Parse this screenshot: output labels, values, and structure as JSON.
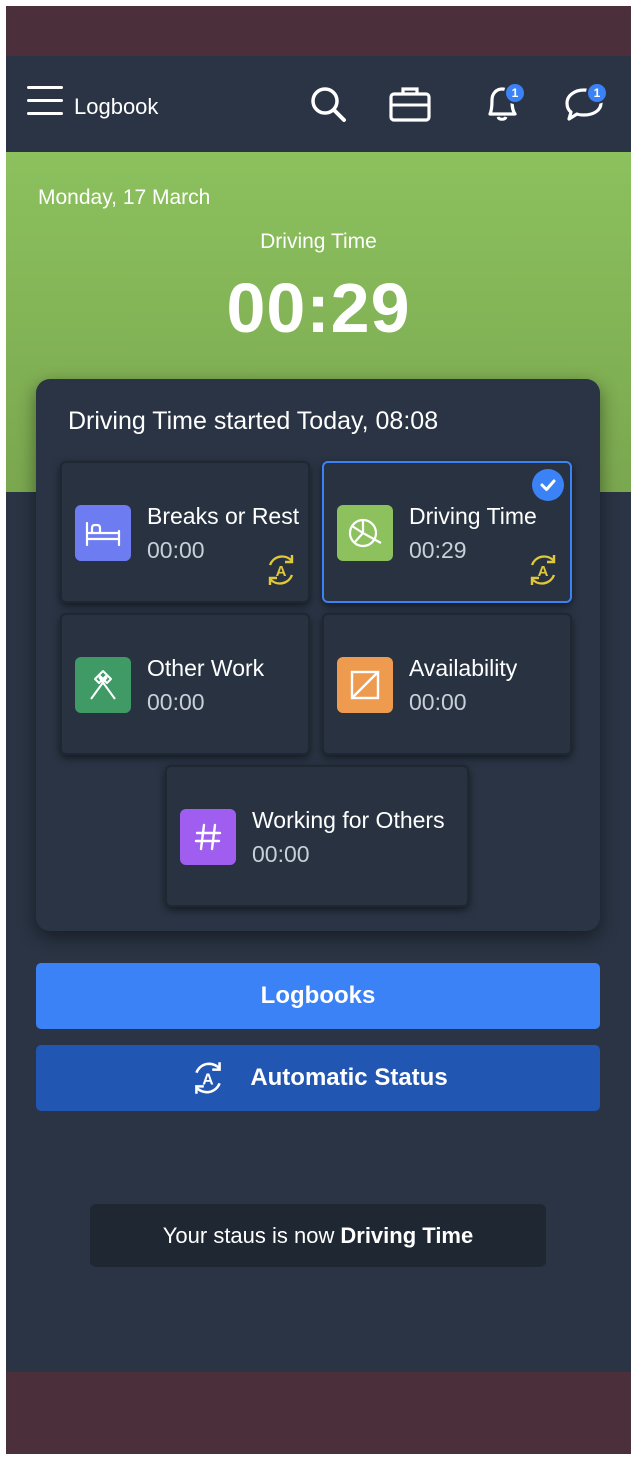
{
  "header": {
    "title": "Logbook",
    "notifications_badge": "1",
    "messages_badge": "1"
  },
  "hero": {
    "date": "Monday, 17 March",
    "label": "Driving Time",
    "time": "00:29"
  },
  "card": {
    "title": "Driving Time started Today, 08:08",
    "tiles": [
      {
        "name": "Breaks or Rest",
        "time": "00:00",
        "icon": "bed-icon",
        "color": "#6d7cf0",
        "auto": true,
        "active": false
      },
      {
        "name": "Driving Time",
        "time": "00:29",
        "icon": "steering-wheel-icon",
        "color": "#8cc15e",
        "auto": true,
        "active": true
      },
      {
        "name": "Other Work",
        "time": "00:00",
        "icon": "hammers-icon",
        "color": "#3f9a66",
        "auto": false,
        "active": false
      },
      {
        "name": "Availability",
        "time": "00:00",
        "icon": "availability-icon",
        "color": "#ee9a4f",
        "auto": false,
        "active": false
      },
      {
        "name": "Working for Others",
        "time": "00:00",
        "icon": "hash-icon",
        "color": "#9f5ef0",
        "auto": false,
        "active": false
      }
    ]
  },
  "buttons": {
    "logbooks": "Logbooks",
    "automatic_status": "Automatic Status"
  },
  "toast": {
    "prefix": "Your staus is now",
    "status": "Driving Time"
  },
  "colors": {
    "accent": "#3b82f6",
    "auto_icon": "#e0c83a",
    "frame_strip": "#4b2f3b",
    "background": "#2a3444"
  }
}
